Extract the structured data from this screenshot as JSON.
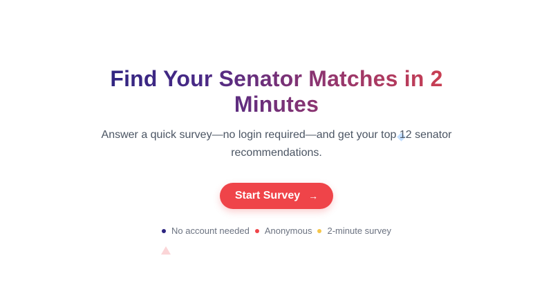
{
  "hero": {
    "title": "Find Your Senator Matches in 2 Minutes",
    "subtitle": "Answer a quick survey—no login required—and get your top 12 senator recommendations.",
    "cta_label": "Start Survey",
    "cta_icon": "arrow-right-icon"
  },
  "features": [
    {
      "label": "No account needed",
      "color": "#2c2480"
    },
    {
      "label": "Anonymous",
      "color": "#ef4449"
    },
    {
      "label": "2-minute survey",
      "color": "#f6c64a"
    }
  ],
  "colors": {
    "title_gradient_start": "#2c2480",
    "title_gradient_end": "#d3404d",
    "accent": "#ef4449"
  }
}
